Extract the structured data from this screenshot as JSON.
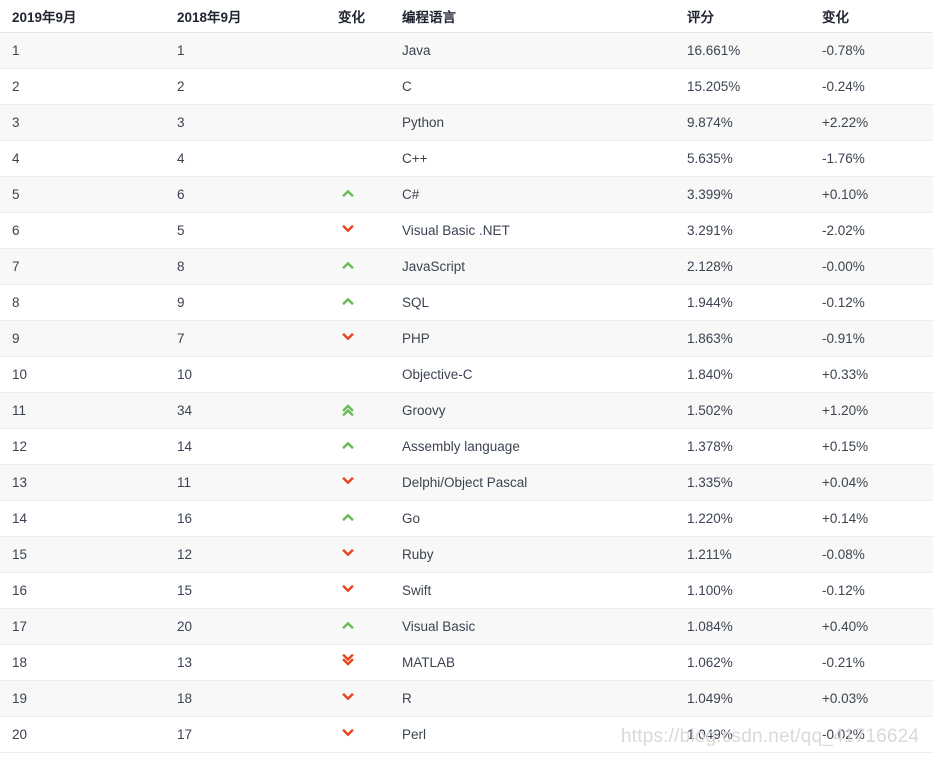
{
  "table": {
    "headers": {
      "rank_new": "2019年9月",
      "rank_old": "2018年9月",
      "change": "变化",
      "language": "编程语言",
      "rating": "评分",
      "delta": "变化"
    },
    "rows": [
      {
        "rank_new": "1",
        "rank_old": "1",
        "trend": "none",
        "language": "Java",
        "rating": "16.661%",
        "delta": "-0.78%"
      },
      {
        "rank_new": "2",
        "rank_old": "2",
        "trend": "none",
        "language": "C",
        "rating": "15.205%",
        "delta": "-0.24%"
      },
      {
        "rank_new": "3",
        "rank_old": "3",
        "trend": "none",
        "language": "Python",
        "rating": "9.874%",
        "delta": "+2.22%"
      },
      {
        "rank_new": "4",
        "rank_old": "4",
        "trend": "none",
        "language": "C++",
        "rating": "5.635%",
        "delta": "-1.76%"
      },
      {
        "rank_new": "5",
        "rank_old": "6",
        "trend": "up",
        "language": "C#",
        "rating": "3.399%",
        "delta": "+0.10%"
      },
      {
        "rank_new": "6",
        "rank_old": "5",
        "trend": "down",
        "language": "Visual Basic .NET",
        "rating": "3.291%",
        "delta": "-2.02%"
      },
      {
        "rank_new": "7",
        "rank_old": "8",
        "trend": "up",
        "language": "JavaScript",
        "rating": "2.128%",
        "delta": "-0.00%"
      },
      {
        "rank_new": "8",
        "rank_old": "9",
        "trend": "up",
        "language": "SQL",
        "rating": "1.944%",
        "delta": "-0.12%"
      },
      {
        "rank_new": "9",
        "rank_old": "7",
        "trend": "down",
        "language": "PHP",
        "rating": "1.863%",
        "delta": "-0.91%"
      },
      {
        "rank_new": "10",
        "rank_old": "10",
        "trend": "none",
        "language": "Objective-C",
        "rating": "1.840%",
        "delta": "+0.33%"
      },
      {
        "rank_new": "11",
        "rank_old": "34",
        "trend": "up-double",
        "language": "Groovy",
        "rating": "1.502%",
        "delta": "+1.20%"
      },
      {
        "rank_new": "12",
        "rank_old": "14",
        "trend": "up",
        "language": "Assembly language",
        "rating": "1.378%",
        "delta": "+0.15%"
      },
      {
        "rank_new": "13",
        "rank_old": "11",
        "trend": "down",
        "language": "Delphi/Object Pascal",
        "rating": "1.335%",
        "delta": "+0.04%"
      },
      {
        "rank_new": "14",
        "rank_old": "16",
        "trend": "up",
        "language": "Go",
        "rating": "1.220%",
        "delta": "+0.14%"
      },
      {
        "rank_new": "15",
        "rank_old": "12",
        "trend": "down",
        "language": "Ruby",
        "rating": "1.211%",
        "delta": "-0.08%"
      },
      {
        "rank_new": "16",
        "rank_old": "15",
        "trend": "down",
        "language": "Swift",
        "rating": "1.100%",
        "delta": "-0.12%"
      },
      {
        "rank_new": "17",
        "rank_old": "20",
        "trend": "up",
        "language": "Visual Basic",
        "rating": "1.084%",
        "delta": "+0.40%"
      },
      {
        "rank_new": "18",
        "rank_old": "13",
        "trend": "down-double",
        "language": "MATLAB",
        "rating": "1.062%",
        "delta": "-0.21%"
      },
      {
        "rank_new": "19",
        "rank_old": "18",
        "trend": "down",
        "language": "R",
        "rating": "1.049%",
        "delta": "+0.03%"
      },
      {
        "rank_new": "20",
        "rank_old": "17",
        "trend": "down",
        "language": "Perl",
        "rating": "1.049%",
        "delta": "-0.02%"
      }
    ]
  },
  "watermark": {
    "text": "https://blog.csdn.net/qq_41716624"
  },
  "icons": {
    "up": "chevron-up-icon",
    "down": "chevron-down-icon",
    "up_double": "chevron-double-up-icon",
    "down_double": "chevron-double-down-icon"
  },
  "colors": {
    "up": "#6aba5a",
    "down": "#e8441a",
    "row_odd_bg": "#f8f8f8",
    "row_even_bg": "#ffffff",
    "text": "#3b4351",
    "header_text": "#1f2430",
    "watermark": "#d9d9d9"
  }
}
